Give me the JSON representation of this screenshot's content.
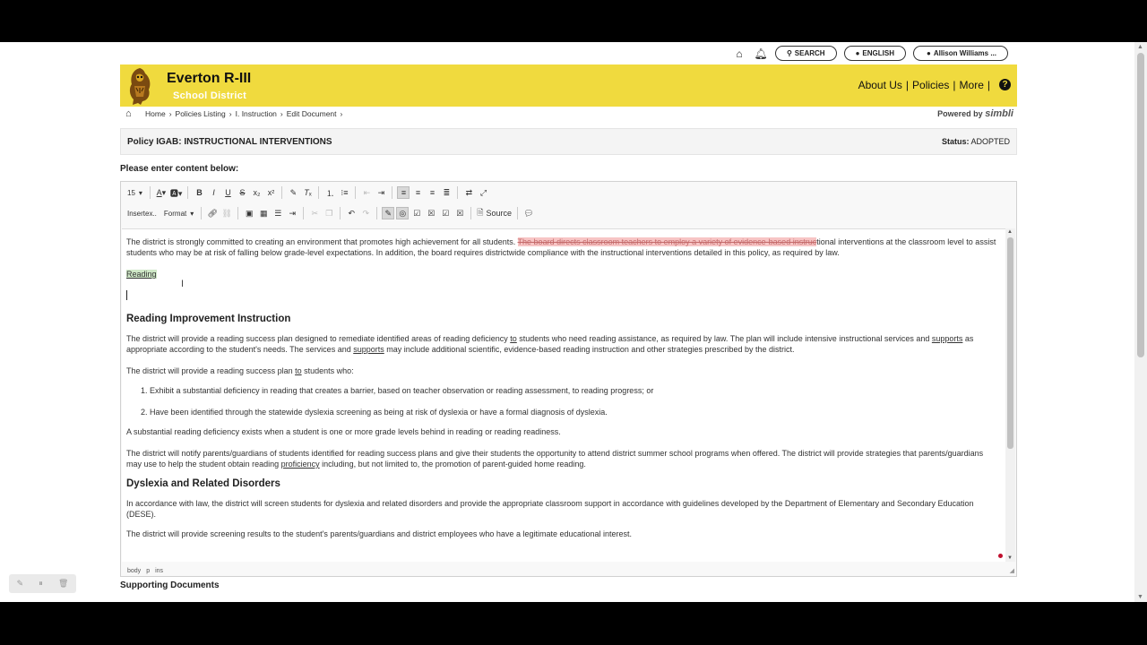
{
  "topnav": {
    "search": "SEARCH",
    "language": "ENGLISH",
    "user": "Allison Williams ..."
  },
  "banner": {
    "title": "Everton R-III",
    "subtitle": "School District",
    "nav": [
      "About Us",
      "Policies",
      "More"
    ],
    "help": "?",
    "colors": {
      "banner": "#f0da3e"
    }
  },
  "breadcrumb": {
    "items": [
      "Home",
      "Policies Listing",
      "I. Instruction",
      "Edit Document"
    ],
    "powered_by_label": "Powered by",
    "powered_by_brand": "simbli"
  },
  "policy": {
    "title": "Policy IGAB: INSTRUCTIONAL INTERVENTIONS",
    "status_label": "Status:",
    "status_value": "ADOPTED"
  },
  "editor": {
    "prompt": "Please enter content below:",
    "font_size": "15",
    "insert_label": "Insertex..",
    "format_label": "Format",
    "source_label": "Source",
    "status_path": [
      "body",
      "p",
      "ins"
    ],
    "content": {
      "p1_before": "The district is strongly committed to creating an environment that promotes high achievement for all students. ",
      "p1_deleted": "The board directs classroom teachers to employ a variety of evidence-based instruc",
      "p1_after": "tional interventions at the classroom level to assist students who may be at risk of falling below grade-level expectations. In addition, the board requires districtwide compliance with the instructional interventions detailed in this policy, as required by law.",
      "inserted_heading": "Reading",
      "h_reading": "Reading Improvement Instruction",
      "p2_a": "The district will provide a reading success plan designed to remediate identified areas of reading deficiency ",
      "p2_to": "to",
      "p2_b": " students who need reading assistance, as required by law. The plan will include intensive instructional services and ",
      "p2_supports1": "supports",
      "p2_c": " as appropriate according to the student's needs. The services and ",
      "p2_supports2": "supports",
      "p2_d": " may include additional scientific, evidence-based reading instruction and other strategies prescribed by the district.",
      "p3_a": "The district will provide a reading success plan ",
      "p3_to": "to",
      "p3_b": " students who:",
      "li1": "Exhibit a substantial deficiency in reading that creates a barrier, based on teacher observation or reading assessment, to reading progress; or",
      "li2": "Have been identified through the statewide dyslexia screening as being at risk of dyslexia or have a formal diagnosis of dyslexia.",
      "p4": "A substantial reading deficiency exists when a student is one or more grade levels behind in reading or reading readiness.",
      "p5_a": "The district will notify parents/guardians of students identified for reading success plans and give their students the opportunity to attend district summer school programs when offered. The district will provide strategies that parents/guardians may use to help the student obtain reading ",
      "p5_prof": "proficiency",
      "p5_b": " including, but not limited to, the promotion of parent-guided home reading.",
      "h_dyslexia": "Dyslexia and Related Disorders",
      "p6": "In accordance with law, the district will screen students for dyslexia and related disorders and provide the appropriate classroom support in accordance with guidelines developed by the Department of Elementary and Secondary Education (DESE).",
      "p7": "The district will provide screening results to the student's parents/guardians and district employees who have a legitimate educational interest."
    }
  },
  "supporting_docs": "Supporting Documents"
}
